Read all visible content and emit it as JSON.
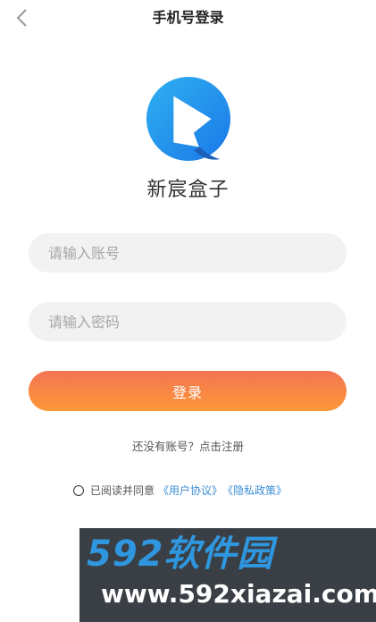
{
  "header": {
    "title": "手机号登录",
    "back_icon": "chevron-left-icon"
  },
  "app": {
    "name": "新宸盒子",
    "logo_icon": "play-logo-icon",
    "brand_colors": [
      "#2fb0f0",
      "#1a78e8"
    ]
  },
  "form": {
    "account_placeholder": "请输入账号",
    "account_value": "",
    "password_placeholder": "请输入密码",
    "password_value": "",
    "login_label": "登录",
    "login_gradient": [
      "#f37452",
      "#fd9938"
    ]
  },
  "register": {
    "text": "还没有账号？点击注册"
  },
  "agreement": {
    "checked": false,
    "prefix": "已阅读并同意",
    "user_agreement": "《用户协议》",
    "privacy_policy": "《隐私政策》",
    "link_color": "#3d8ed6"
  },
  "watermark": {
    "brand": "592软件园",
    "url": "www.592xiazai.com"
  }
}
